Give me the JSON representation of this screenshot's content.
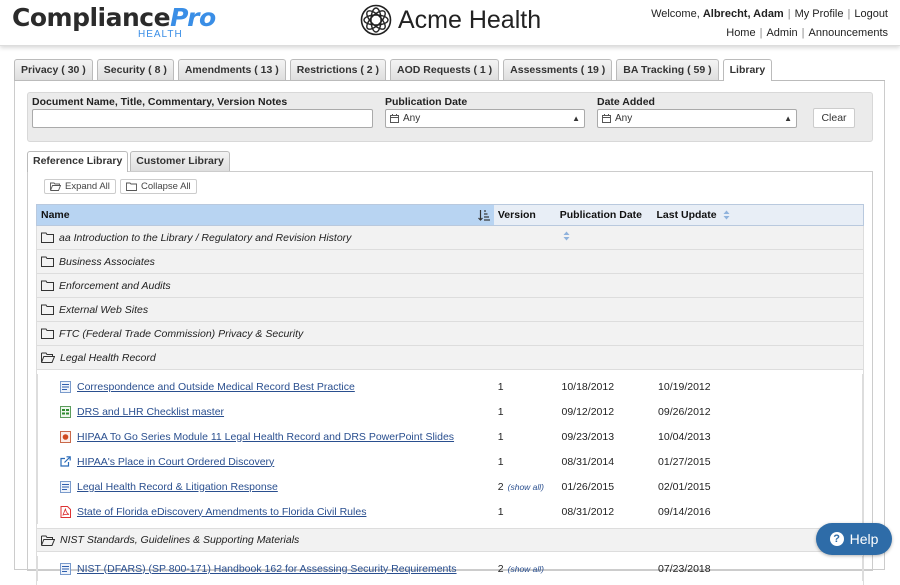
{
  "header": {
    "logo_main_a": "Compliance",
    "logo_main_b": "Pro",
    "logo_sub": "HEALTH",
    "brand_name": "Acme Health",
    "welcome_prefix": "Welcome, ",
    "user_name": "Albrecht, Adam",
    "links_top": [
      "My Profile",
      "Logout"
    ],
    "links_bottom": [
      "Home",
      "Admin",
      "Announcements"
    ]
  },
  "tabs": [
    {
      "label": "Privacy ( 30 )"
    },
    {
      "label": "Security ( 8 )"
    },
    {
      "label": "Amendments ( 13 )"
    },
    {
      "label": "Restrictions ( 2 )"
    },
    {
      "label": "AOD Requests ( 1 )"
    },
    {
      "label": "Assessments ( 19 )"
    },
    {
      "label": "BA Tracking ( 59 )"
    },
    {
      "label": "Library"
    }
  ],
  "filter": {
    "doc_label": "Document Name, Title, Commentary, Version Notes",
    "doc_value": "",
    "pub_label": "Publication Date",
    "pub_value": "Any",
    "added_label": "Date Added",
    "added_value": "Any",
    "clear_label": "Clear"
  },
  "library_tabs": [
    "Reference Library",
    "Customer Library"
  ],
  "expand_all": "Expand All",
  "collapse_all": "Collapse All",
  "columns": {
    "name": "Name",
    "version": "Version",
    "pub": "Publication Date",
    "upd": "Last Update"
  },
  "folders_top": [
    "aa Introduction to the Library / Regulatory and Revision History",
    "Business Associates",
    "Enforcement and Audits",
    "External Web Sites",
    "FTC (Federal Trade Commission) Privacy & Security"
  ],
  "folder_open_1": "Legal Health Record",
  "items_1": [
    {
      "name": "Correspondence and Outside Medical Record Best Practice",
      "icon": "word-doc-icon",
      "version": "1",
      "showall": "",
      "pub": "10/18/2012",
      "upd": "10/19/2012"
    },
    {
      "name": "DRS and LHR Checklist master",
      "icon": "excel-doc-icon",
      "version": "1",
      "showall": "",
      "pub": "09/12/2012",
      "upd": "09/26/2012"
    },
    {
      "name": "HIPAA To Go Series Module 11 Legal Health Record and DRS PowerPoint Slides",
      "icon": "powerpoint-doc-icon",
      "version": "1",
      "showall": "",
      "pub": "09/23/2013",
      "upd": "10/04/2013"
    },
    {
      "name": "HIPAA's Place in Court Ordered Discovery",
      "icon": "external-link-icon",
      "version": "1",
      "showall": "",
      "pub": "08/31/2014",
      "upd": "01/27/2015"
    },
    {
      "name": "Legal Health Record & Litigation Response",
      "icon": "word-doc-icon",
      "version": "2",
      "showall": "(show all)",
      "pub": "01/26/2015",
      "upd": "02/01/2015"
    },
    {
      "name": "State of Florida eDiscovery Amendments to Florida Civil Rules",
      "icon": "pdf-doc-icon",
      "version": "1",
      "showall": "",
      "pub": "08/31/2012",
      "upd": "09/14/2016"
    }
  ],
  "folder_open_2": "NIST Standards, Guidelines & Supporting Materials",
  "items_2": [
    {
      "name": "NIST (DFARS) (SP 800-171) Handbook 162 for Assessing Security Requirements",
      "icon": "word-doc-icon",
      "version": "2",
      "showall": "(show all)",
      "pub": "",
      "upd": "07/23/2018"
    }
  ],
  "help_label": "Help",
  "colors": {
    "accent": "#3a8ee6",
    "link": "#2a4f8f",
    "help_bg": "#2e6ca8",
    "header_sort": "#b8d4f2"
  }
}
